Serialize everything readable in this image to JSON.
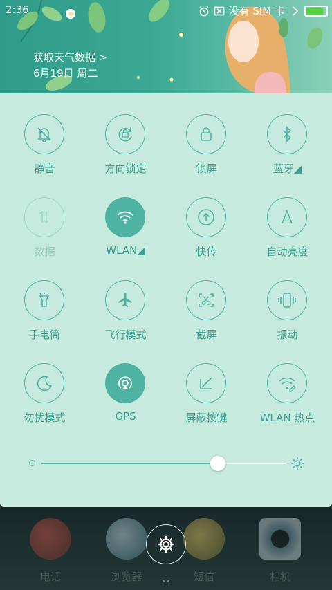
{
  "status_bar": {
    "time": "2:36",
    "carrier": "没有 SIM 卡"
  },
  "header": {
    "weather_link": "获取天气数据 >",
    "date": "6月19日 周二"
  },
  "toggles": [
    {
      "label": "静音",
      "icon": "bell-off-icon",
      "active": false
    },
    {
      "label": "方向锁定",
      "icon": "rotation-lock-icon",
      "active": false
    },
    {
      "label": "锁屏",
      "icon": "lock-icon",
      "active": false
    },
    {
      "label": "蓝牙◢",
      "icon": "bluetooth-icon",
      "active": false
    },
    {
      "label": "数据",
      "icon": "mobile-data-icon",
      "active": false
    },
    {
      "label": "WLAN◢",
      "icon": "wifi-icon",
      "active": true
    },
    {
      "label": "快传",
      "icon": "upload-icon",
      "active": false
    },
    {
      "label": "自动亮度",
      "icon": "auto-brightness-icon",
      "active": false
    },
    {
      "label": "手电筒",
      "icon": "flashlight-icon",
      "active": false
    },
    {
      "label": "飞行模式",
      "icon": "airplane-icon",
      "active": false
    },
    {
      "label": "截屏",
      "icon": "screenshot-icon",
      "active": false
    },
    {
      "label": "振动",
      "icon": "vibrate-icon",
      "active": false
    },
    {
      "label": "勿扰模式",
      "icon": "moon-icon",
      "active": false
    },
    {
      "label": "GPS",
      "icon": "gps-icon",
      "active": true
    },
    {
      "label": "屏蔽按键",
      "icon": "block-keys-icon",
      "active": false
    },
    {
      "label": "WLAN 热点",
      "icon": "hotspot-icon",
      "active": false
    }
  ],
  "brightness": {
    "level": 0.72
  },
  "dock": {
    "apps": [
      {
        "name": "电话"
      },
      {
        "name": "浏览器"
      },
      {
        "name": "短信"
      },
      {
        "name": "相机"
      }
    ]
  },
  "colors": {
    "accent": "#4fb3a4",
    "panel": "#c6eadd"
  }
}
